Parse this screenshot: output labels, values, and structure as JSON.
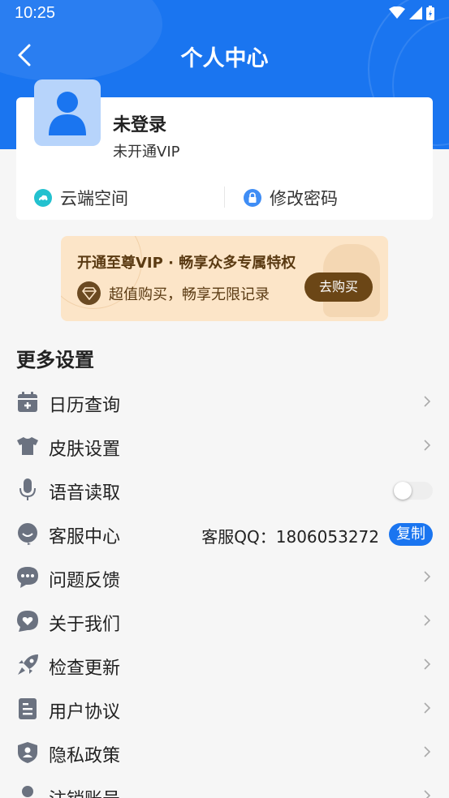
{
  "status_bar": {
    "time": "10:25"
  },
  "header": {
    "title": "个人中心"
  },
  "profile": {
    "login_status": "未登录",
    "vip_status": "未开通VIP"
  },
  "card_actions": [
    {
      "label": "云端空间",
      "icon": "cloud-icon"
    },
    {
      "label": "修改密码",
      "icon": "lock-icon"
    }
  ],
  "vip_banner": {
    "title": "开通至尊VIP · 畅享众多专属特权",
    "subtitle": "超值购买，畅享无限记录",
    "buy_label": "去购买"
  },
  "section": {
    "title": "更多设置"
  },
  "menu": [
    {
      "label": "日历查询",
      "icon": "calendar-icon",
      "trailing": "chevron"
    },
    {
      "label": "皮肤设置",
      "icon": "shirt-icon",
      "trailing": "chevron"
    },
    {
      "label": "语音读取",
      "icon": "microphone-icon",
      "trailing": "toggle",
      "enabled": false
    },
    {
      "label": "客服中心",
      "icon": "customer-service-icon",
      "trailing": "copy",
      "qq_text": "客服QQ：1806053272",
      "copy_label": "复制"
    },
    {
      "label": "问题反馈",
      "icon": "feedback-icon",
      "trailing": "chevron"
    },
    {
      "label": "关于我们",
      "icon": "heart-bubble-icon",
      "trailing": "chevron"
    },
    {
      "label": "检查更新",
      "icon": "rocket-icon",
      "trailing": "chevron"
    },
    {
      "label": "用户协议",
      "icon": "agreement-icon",
      "trailing": "chevron"
    },
    {
      "label": "隐私政策",
      "icon": "privacy-shield-icon",
      "trailing": "chevron"
    },
    {
      "label": "注销账号",
      "icon": "user-icon",
      "trailing": "chevron"
    }
  ],
  "colors": {
    "primary": "#1a75f0",
    "vip_brown": "#6b4616",
    "vip_bg": "#fce5c8",
    "icon_gray": "#6b7280"
  }
}
